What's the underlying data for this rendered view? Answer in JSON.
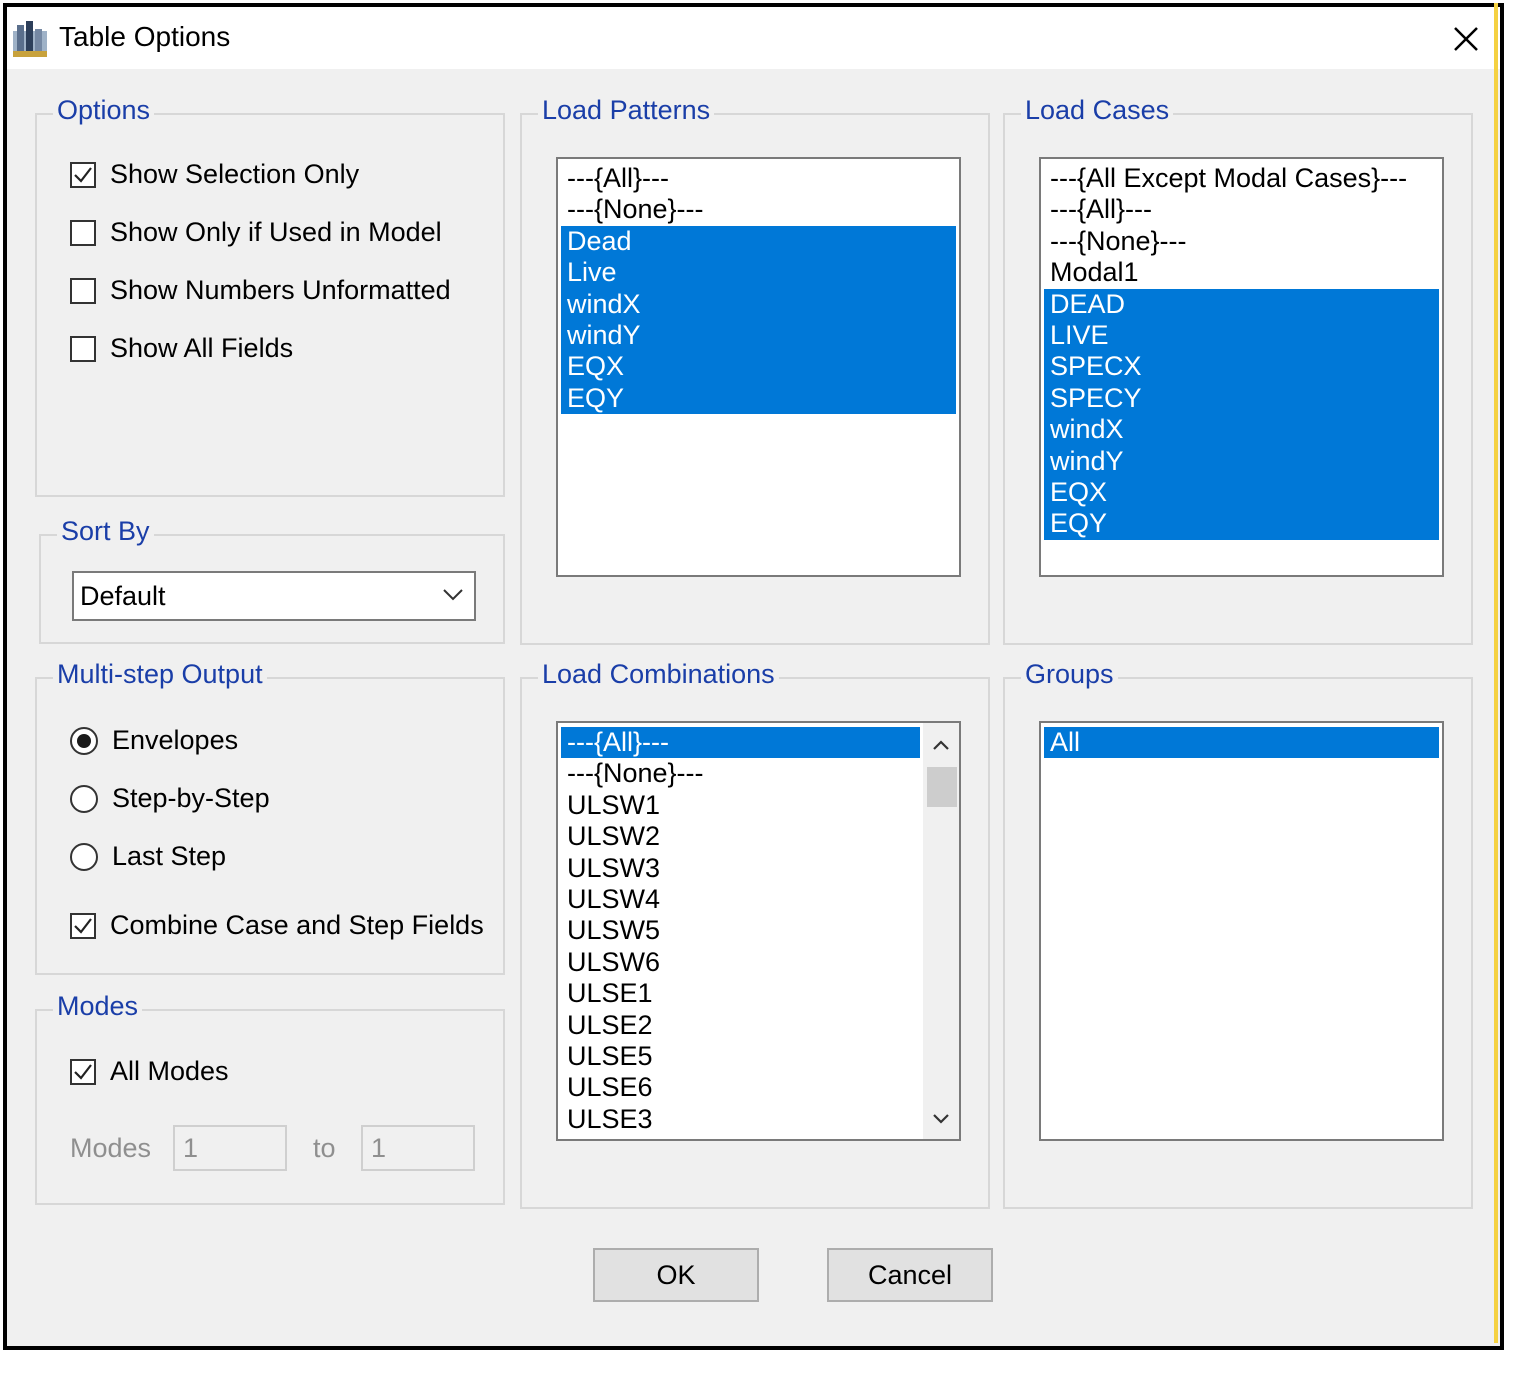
{
  "window": {
    "title": "Table Options"
  },
  "options": {
    "label": "Options",
    "items": [
      {
        "label": "Show Selection Only",
        "checked": true
      },
      {
        "label": "Show Only if Used in Model",
        "checked": false
      },
      {
        "label": "Show Numbers Unformatted",
        "checked": false
      },
      {
        "label": "Show All Fields",
        "checked": false
      }
    ]
  },
  "sort_by": {
    "label": "Sort By",
    "value": "Default"
  },
  "multi_step": {
    "label": "Multi-step Output",
    "radios": [
      {
        "label": "Envelopes",
        "selected": true
      },
      {
        "label": "Step-by-Step",
        "selected": false
      },
      {
        "label": "Last Step",
        "selected": false
      }
    ],
    "combine": {
      "label": "Combine Case and Step Fields",
      "checked": true
    }
  },
  "modes": {
    "label": "Modes",
    "all_modes": {
      "label": "All Modes",
      "checked": true
    },
    "range_label": "Modes",
    "from": "1",
    "to_label": "to",
    "to": "1"
  },
  "load_patterns": {
    "label": "Load Patterns",
    "items": [
      {
        "text": "---{All}---",
        "selected": false
      },
      {
        "text": "---{None}---",
        "selected": false
      },
      {
        "text": "Dead",
        "selected": true
      },
      {
        "text": "Live",
        "selected": true
      },
      {
        "text": "windX",
        "selected": true
      },
      {
        "text": "windY",
        "selected": true
      },
      {
        "text": "EQX",
        "selected": true
      },
      {
        "text": "EQY",
        "selected": true
      }
    ]
  },
  "load_cases": {
    "label": "Load Cases",
    "items": [
      {
        "text": "---{All Except Modal Cases}---",
        "selected": false
      },
      {
        "text": "---{All}---",
        "selected": false
      },
      {
        "text": "---{None}---",
        "selected": false
      },
      {
        "text": "Modal1",
        "selected": false
      },
      {
        "text": "DEAD",
        "selected": true
      },
      {
        "text": "LIVE",
        "selected": true
      },
      {
        "text": "SPECX",
        "selected": true
      },
      {
        "text": "SPECY",
        "selected": true
      },
      {
        "text": "windX",
        "selected": true
      },
      {
        "text": "windY",
        "selected": true
      },
      {
        "text": "EQX",
        "selected": true
      },
      {
        "text": "EQY",
        "selected": true
      }
    ]
  },
  "load_combinations": {
    "label": "Load Combinations",
    "items": [
      {
        "text": "---{All}---",
        "selected": true
      },
      {
        "text": "---{None}---",
        "selected": false
      },
      {
        "text": "ULSW1",
        "selected": false
      },
      {
        "text": "ULSW2",
        "selected": false
      },
      {
        "text": "ULSW3",
        "selected": false
      },
      {
        "text": "ULSW4",
        "selected": false
      },
      {
        "text": "ULSW5",
        "selected": false
      },
      {
        "text": "ULSW6",
        "selected": false
      },
      {
        "text": "ULSE1",
        "selected": false
      },
      {
        "text": "ULSE2",
        "selected": false
      },
      {
        "text": "ULSE5",
        "selected": false
      },
      {
        "text": "ULSE6",
        "selected": false
      },
      {
        "text": "ULSE3",
        "selected": false
      }
    ]
  },
  "groups": {
    "label": "Groups",
    "items": [
      {
        "text": "All",
        "selected": true
      }
    ]
  },
  "buttons": {
    "ok": "OK",
    "cancel": "Cancel"
  },
  "colors": {
    "selection": "#0078d7",
    "group_label": "#1a3ea8"
  },
  "icons": {
    "app": "app-structure-icon",
    "close": "close-icon",
    "dropdown": "chevron-down-icon"
  }
}
